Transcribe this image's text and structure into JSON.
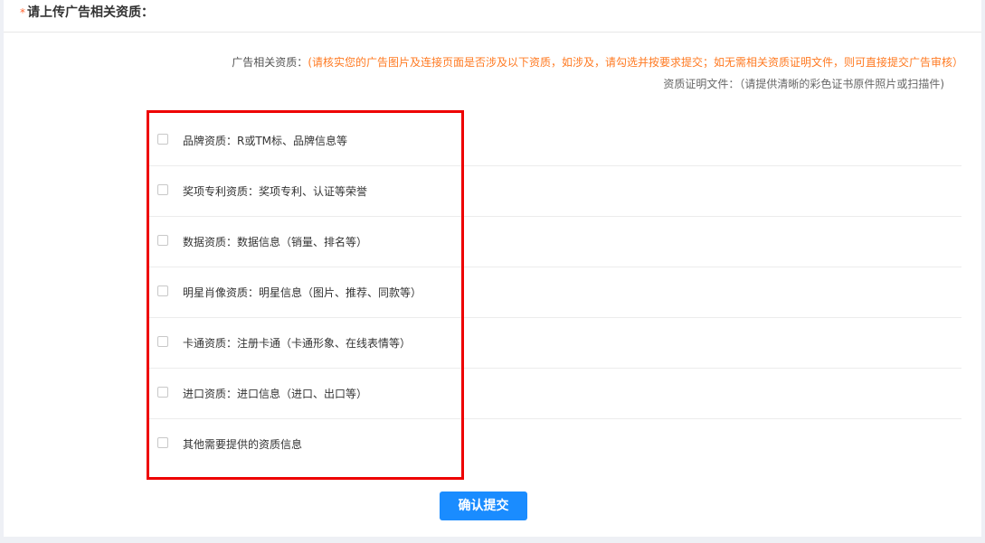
{
  "section": {
    "required_mark": "*",
    "title": "请上传广告相关资质："
  },
  "description": {
    "label": "广告相关资质：",
    "note": "(请核实您的广告图片及连接页面是否涉及以下资质，如涉及，请勾选并按要求提交；如无需相关资质证明文件，则可直接提交广告审核）",
    "proof_hint": "资质证明文件：（请提供清晰的彩色证书原件照片或扫描件)"
  },
  "qualifications": [
    {
      "label": "品牌资质：R或TM标、品牌信息等",
      "checked": false
    },
    {
      "label": "奖项专利资质：奖项专利、认证等荣誉",
      "checked": false
    },
    {
      "label": "数据资质：数据信息（销量、排名等）",
      "checked": false
    },
    {
      "label": "明星肖像资质：明星信息（图片、推荐、同款等）",
      "checked": false
    },
    {
      "label": "卡通资质：注册卡通（卡通形象、在线表情等）",
      "checked": false
    },
    {
      "label": "进口资质：进口信息（进口、出口等）",
      "checked": false
    },
    {
      "label": "其他需要提供的资质信息",
      "checked": false
    }
  ],
  "submit": {
    "label": "确认提交"
  },
  "colors": {
    "accent": "#1a8cff",
    "note": "#ff7a22",
    "highlight": "#ee0000"
  }
}
